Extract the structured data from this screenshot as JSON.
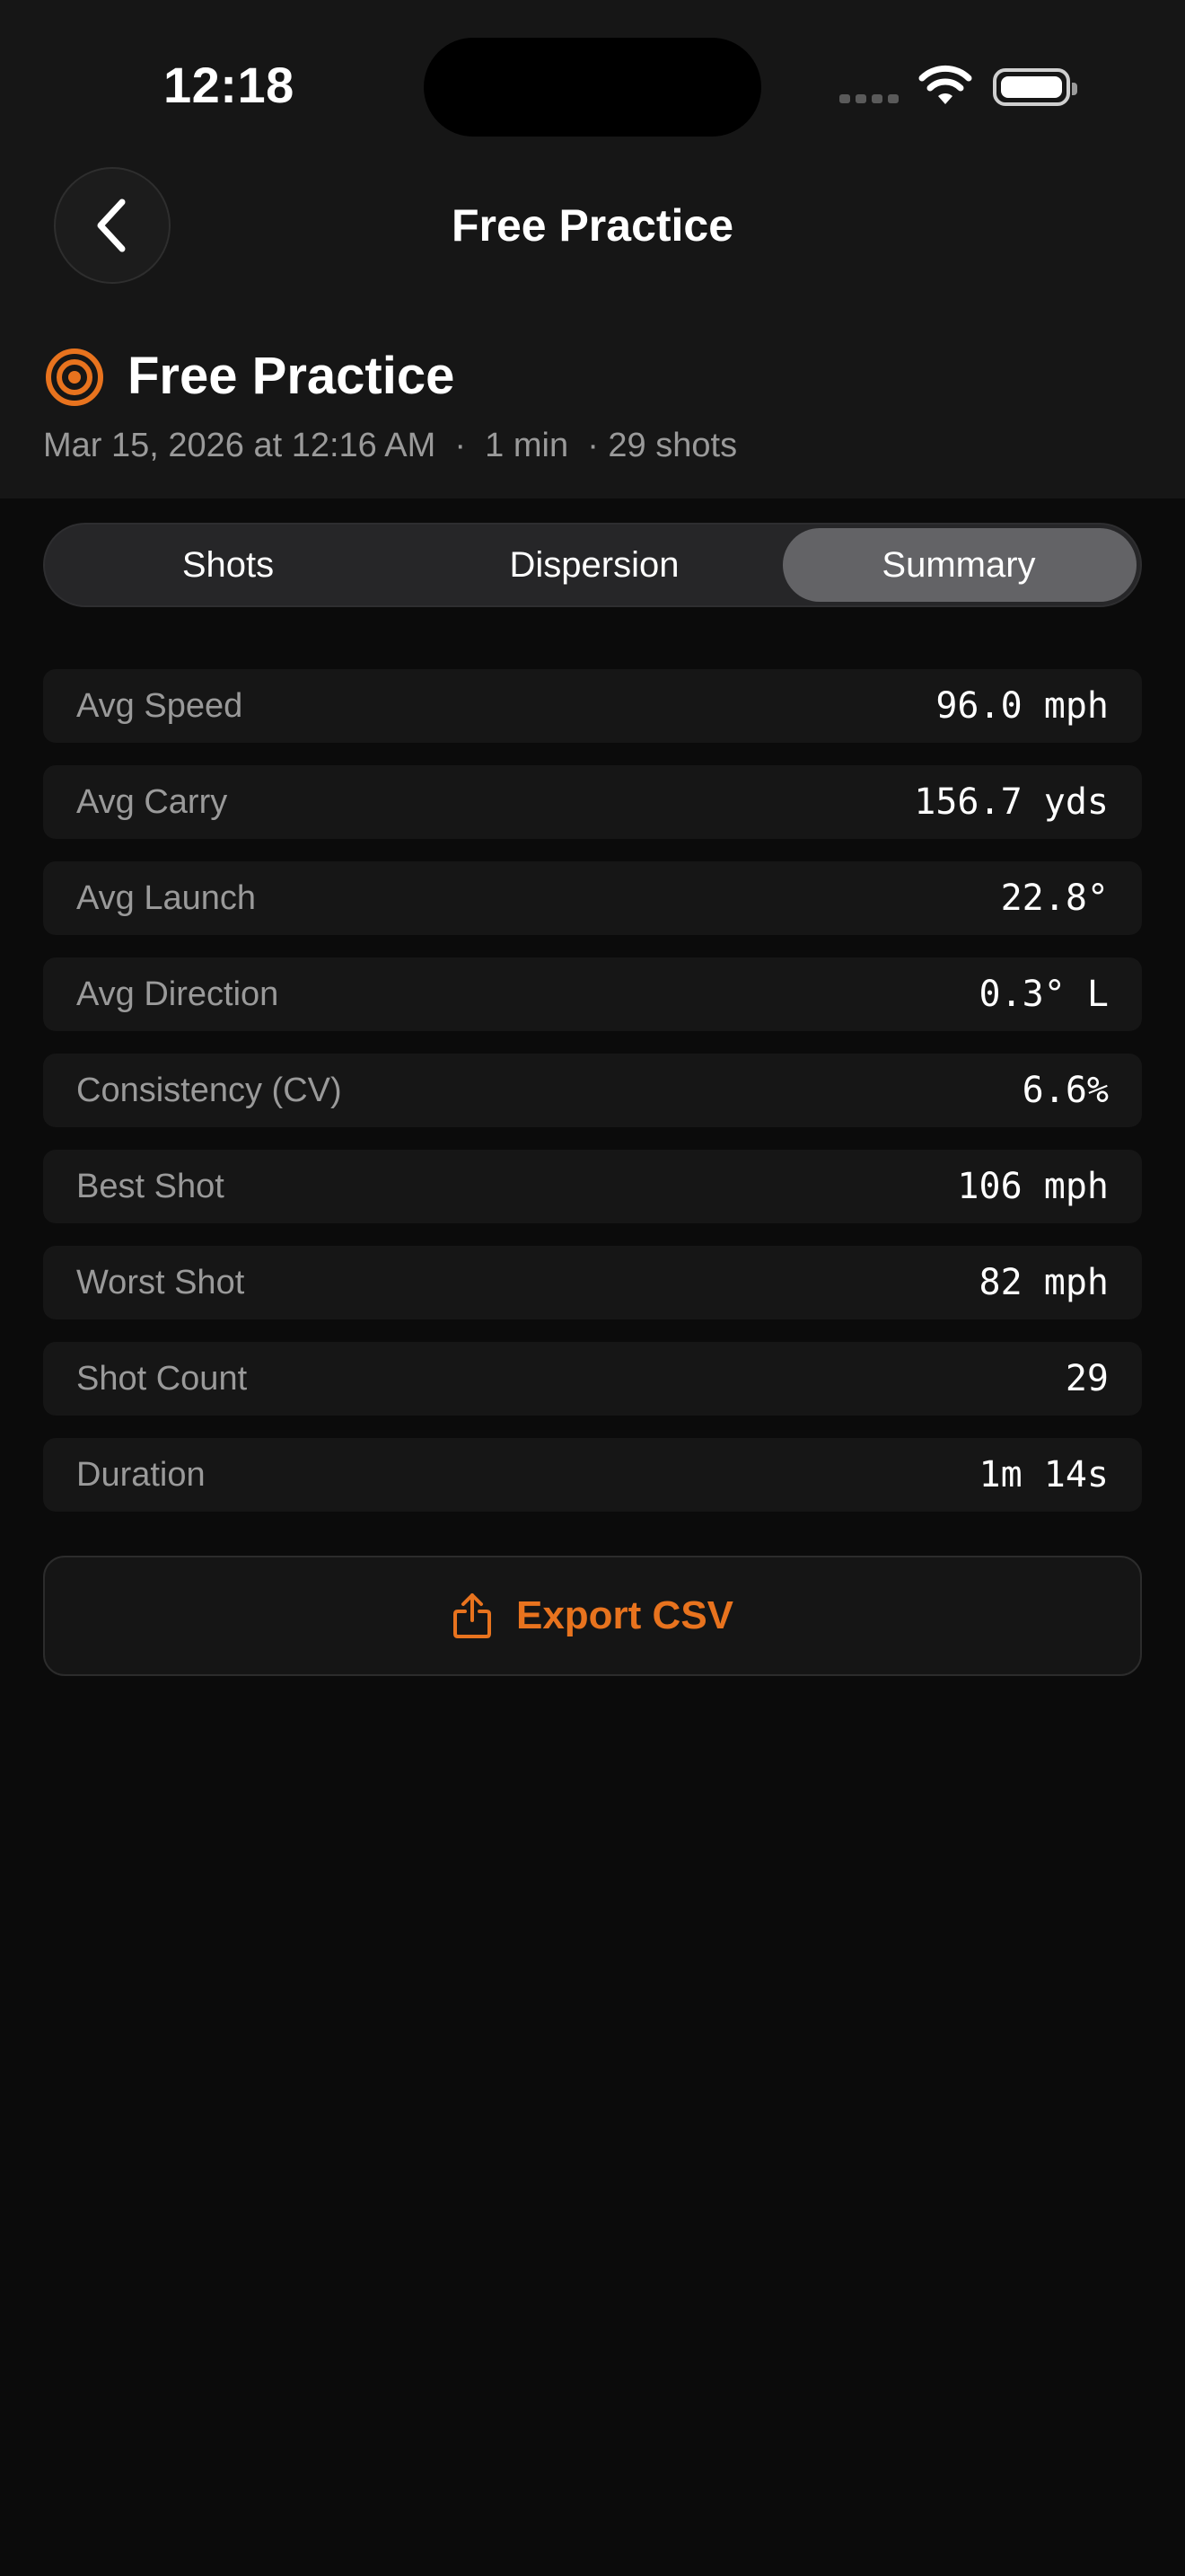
{
  "status_bar": {
    "time": "12:18",
    "icons": [
      "cellular-signal-icon",
      "wifi-icon",
      "battery-icon"
    ]
  },
  "nav": {
    "back_icon": "chevron-left-icon",
    "title": "Free Practice"
  },
  "session": {
    "icon": "target-icon",
    "title": "Free Practice",
    "meta": "Mar 15, 2026 at 12:16 AM  ·  1 min  · 29 shots"
  },
  "tabs": [
    {
      "label": "Shots",
      "selected": false
    },
    {
      "label": "Dispersion",
      "selected": false
    },
    {
      "label": "Summary",
      "selected": true
    }
  ],
  "stats": [
    {
      "label": "Avg Speed",
      "value": "96.0 mph"
    },
    {
      "label": "Avg Carry",
      "value": "156.7 yds"
    },
    {
      "label": "Avg Launch",
      "value": "22.8°"
    },
    {
      "label": "Avg Direction",
      "value": "0.3° L"
    },
    {
      "label": "Consistency (CV)",
      "value": "6.6%"
    },
    {
      "label": "Best Shot",
      "value": "106 mph"
    },
    {
      "label": "Worst Shot",
      "value": "82 mph"
    },
    {
      "label": "Shot Count",
      "value": "29"
    },
    {
      "label": "Duration",
      "value": "1m 14s"
    }
  ],
  "export": {
    "icon": "share-icon",
    "label": "Export CSV"
  },
  "colors": {
    "accent": "#e8731e",
    "background": "#0b0b0b",
    "header_background": "#161616",
    "row_background": "#161616",
    "muted_text": "#9a9a9a",
    "segment_selected": "#636366"
  }
}
